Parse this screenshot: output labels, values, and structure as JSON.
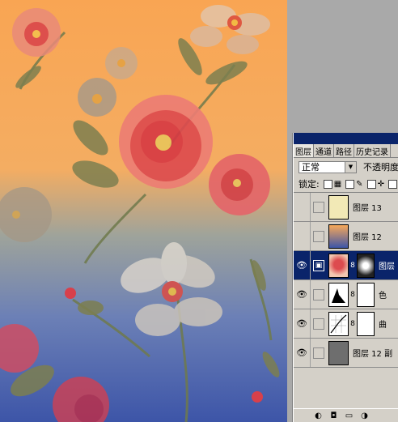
{
  "panel": {
    "tabs": [
      {
        "label": "图层",
        "active": true
      },
      {
        "label": "通道",
        "active": false
      },
      {
        "label": "路径",
        "active": false
      },
      {
        "label": "历史记录",
        "active": false
      }
    ],
    "blend_mode": "正常",
    "opacity_label": "不透明度",
    "lock_label": "锁定:",
    "lock_icons": [
      "transparency-lock-icon",
      "image-lock-icon",
      "position-lock-icon",
      "all-lock-icon"
    ],
    "layers": [
      {
        "name": "图层 13",
        "visible": false,
        "selected": false,
        "thumb": "pale-yellow",
        "has_mask": false
      },
      {
        "name": "图层 12",
        "visible": false,
        "selected": false,
        "thumb": "floral-small",
        "has_mask": false
      },
      {
        "name": "图层",
        "visible": true,
        "selected": true,
        "thumb": "floral",
        "has_mask": true
      },
      {
        "name": "色",
        "visible": true,
        "selected": false,
        "thumb": "levels-adjustment",
        "has_mask": true
      },
      {
        "name": "曲",
        "visible": true,
        "selected": false,
        "thumb": "curves-adjustment",
        "has_mask": true
      },
      {
        "name": "图层 12 副",
        "visible": true,
        "selected": false,
        "thumb": "gray",
        "has_mask": false
      }
    ],
    "bottom_icons": [
      "layer-style-icon",
      "mask-icon",
      "new-set-icon",
      "adjustment-layer-icon"
    ]
  },
  "colors": {
    "canvas_top": "#f7a85a",
    "canvas_bottom": "#3a55a6",
    "panel_bg": "#d4d0c8",
    "selected": "#0a246a"
  }
}
